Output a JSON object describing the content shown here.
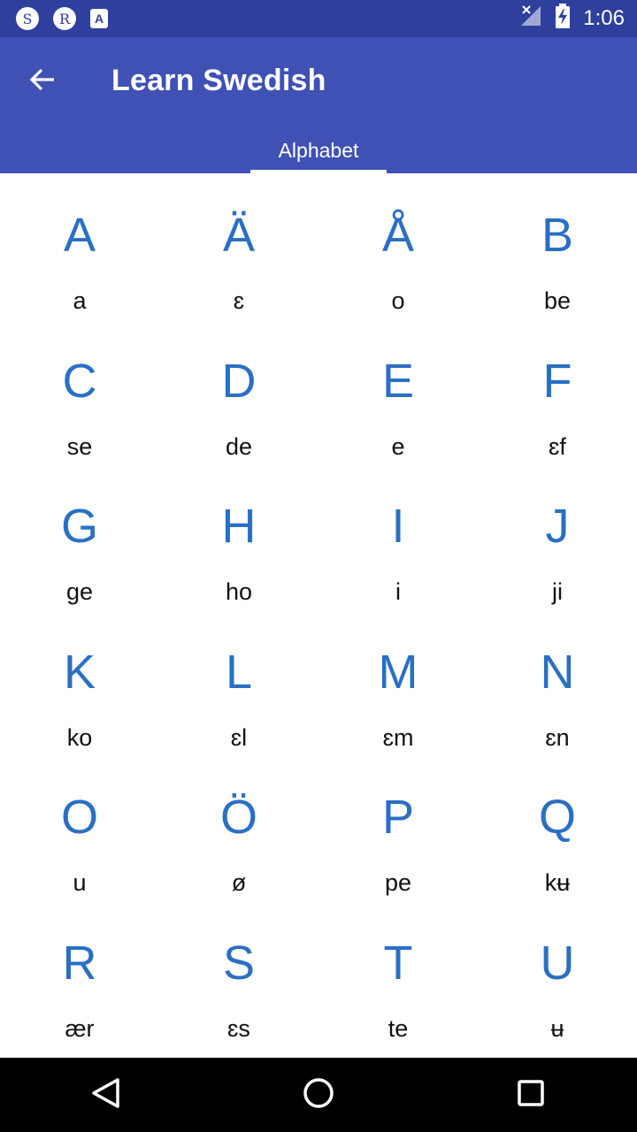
{
  "status_bar": {
    "notifications": [
      "S",
      "R",
      "A"
    ],
    "time": "1:06",
    "icons": [
      "signal-off-icon",
      "battery-charging-icon"
    ]
  },
  "app_bar": {
    "title": "Learn Swedish",
    "back_icon": "arrow-back-icon"
  },
  "tabs": [
    {
      "label": "Alphabet",
      "selected": true
    }
  ],
  "letters": [
    {
      "letter": "A",
      "pron": "a"
    },
    {
      "letter": "Ä",
      "pron": "ɛ"
    },
    {
      "letter": "Å",
      "pron": "o"
    },
    {
      "letter": "B",
      "pron": "be"
    },
    {
      "letter": "C",
      "pron": "se"
    },
    {
      "letter": "D",
      "pron": "de"
    },
    {
      "letter": "E",
      "pron": "e"
    },
    {
      "letter": "F",
      "pron": "ɛf"
    },
    {
      "letter": "G",
      "pron": "ge"
    },
    {
      "letter": "H",
      "pron": "ho"
    },
    {
      "letter": "I",
      "pron": "i"
    },
    {
      "letter": "J",
      "pron": "ji"
    },
    {
      "letter": "K",
      "pron": "ko"
    },
    {
      "letter": "L",
      "pron": "ɛl"
    },
    {
      "letter": "M",
      "pron": "ɛm"
    },
    {
      "letter": "N",
      "pron": "ɛn"
    },
    {
      "letter": "O",
      "pron": "u"
    },
    {
      "letter": "Ö",
      "pron": "ø"
    },
    {
      "letter": "P",
      "pron": "pe"
    },
    {
      "letter": "Q",
      "pron": "kʉ"
    },
    {
      "letter": "R",
      "pron": "ær"
    },
    {
      "letter": "S",
      "pron": "ɛs"
    },
    {
      "letter": "T",
      "pron": "te"
    },
    {
      "letter": "U",
      "pron": "ʉ"
    }
  ],
  "colors": {
    "status_bar": "#2f3f9e",
    "app_bar": "#3f51b5",
    "letter": "#2a6fc4",
    "nav_bar": "#000000"
  },
  "nav": [
    "back-nav-icon",
    "home-nav-icon",
    "recents-nav-icon"
  ]
}
